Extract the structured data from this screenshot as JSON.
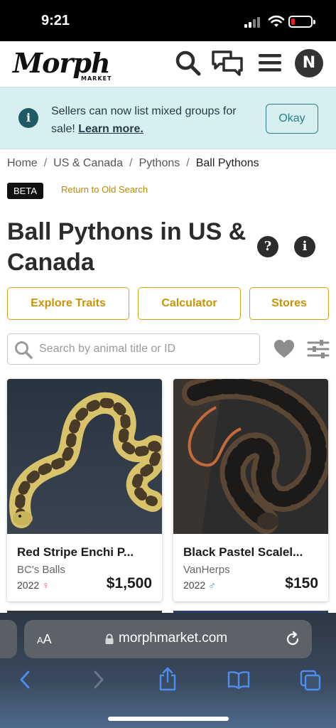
{
  "status_bar": {
    "time": "9:21"
  },
  "header": {
    "logo_text": "Morph",
    "logo_sub": "MARKET",
    "avatar_initial": "N"
  },
  "banner": {
    "message": "Sellers can now list mixed groups for sale!",
    "link": "Learn more.",
    "button": "Okay"
  },
  "breadcrumb": {
    "items": [
      "Home",
      "US & Canada",
      "Pythons",
      "Ball Pythons"
    ],
    "separator": "/"
  },
  "beta_badge": "BETA",
  "old_search_link": "Return to Old Search",
  "page_title": "Ball Pythons in US & Canada",
  "action_buttons": [
    "Explore Traits",
    "Calculator",
    "Stores"
  ],
  "search": {
    "placeholder": "Search by animal title or ID"
  },
  "listings": [
    {
      "name": "Red Stripe Enchi P...",
      "seller": "BC's Balls",
      "year": "2022",
      "sex_symbol": "♀",
      "sex_color": "#e0457b",
      "price": "$1,500"
    },
    {
      "name": "Black Pastel Scalel...",
      "seller": "VanHerps",
      "year": "2022",
      "sex_symbol": "♂",
      "sex_color": "#2a7fd4",
      "price": "$150"
    }
  ],
  "browser": {
    "aa_small": "A",
    "aa_large": "A",
    "url": "morphmarket.com"
  },
  "colors": {
    "accent": "#d4a017",
    "banner_bg": "#d8eff2",
    "banner_button": "#2a7f87"
  }
}
